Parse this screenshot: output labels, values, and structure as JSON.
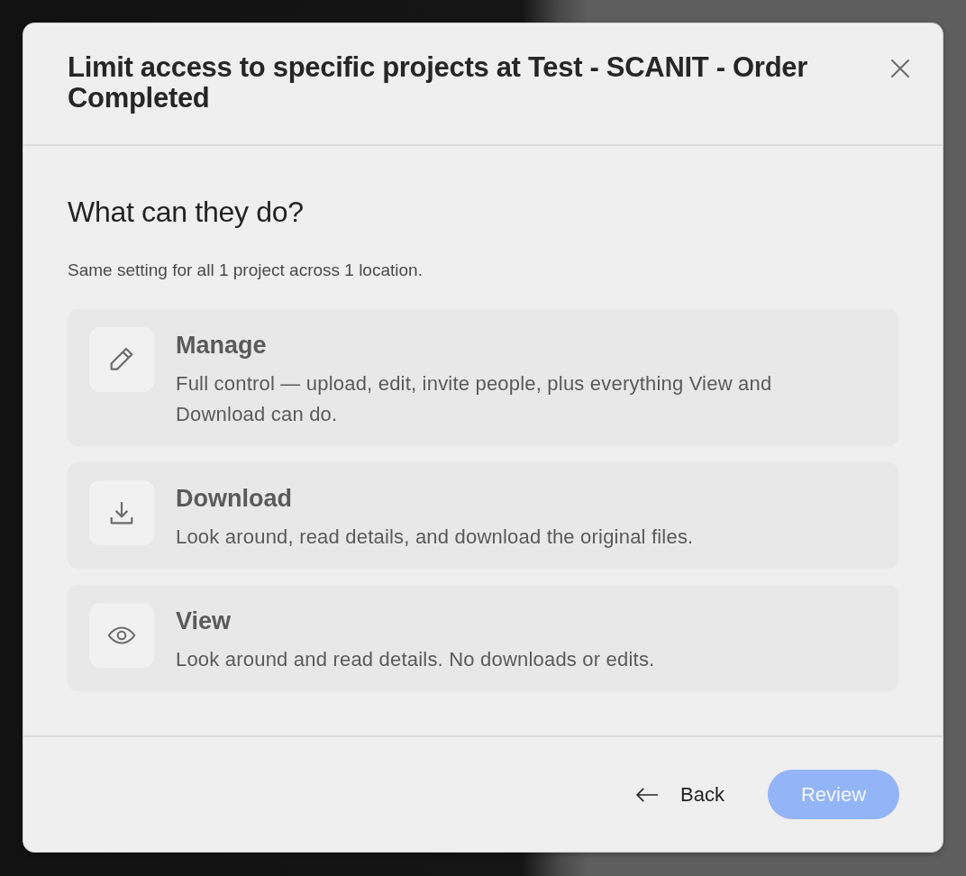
{
  "dialog": {
    "title": "Limit access to specific projects at Test - SCANIT - Order Completed"
  },
  "section": {
    "heading": "What can they do?",
    "subtitle": "Same setting for all 1 project across 1 location."
  },
  "options": [
    {
      "kind": "manage",
      "title": "Manage",
      "description": "Full control — upload, edit, invite people, plus everything View and Download can do.",
      "selected": false
    },
    {
      "kind": "download",
      "title": "Download",
      "description": "Look around, read details, and download the original files.",
      "selected": false
    },
    {
      "kind": "view",
      "title": "View",
      "description": "Look around and read details. No downloads or edits.",
      "selected": false
    }
  ],
  "footer": {
    "back_label": "Back",
    "review": {
      "label": "Review",
      "disabled": true
    }
  }
}
